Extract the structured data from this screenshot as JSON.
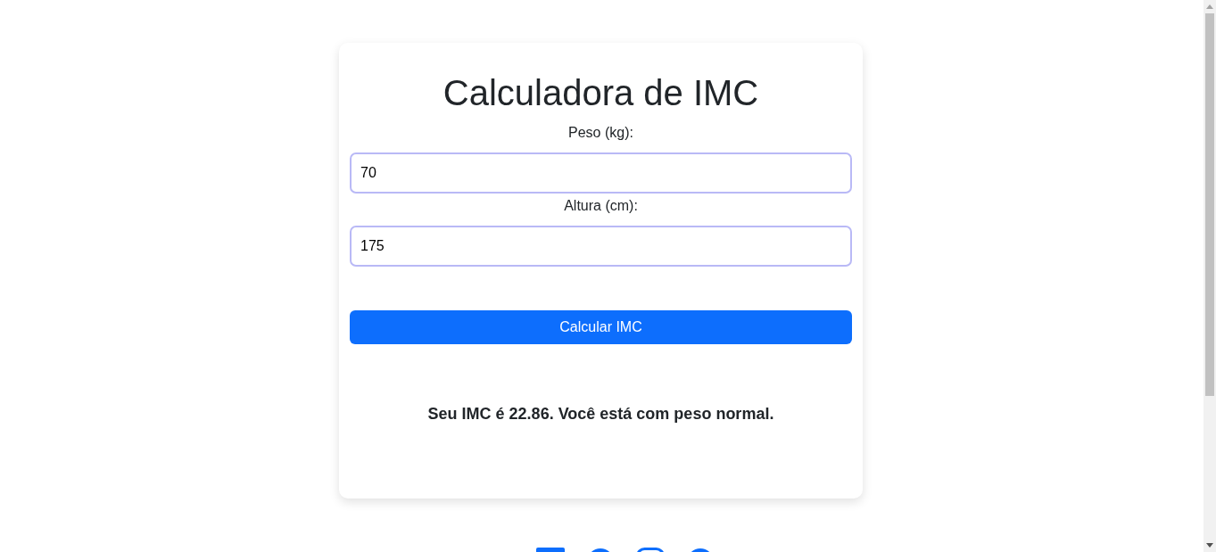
{
  "title": "Calculadora de IMC",
  "fields": [
    {
      "label": "Peso (kg):",
      "value": "70"
    },
    {
      "label": "Altura (cm):",
      "value": "175"
    }
  ],
  "button": "Calcular IMC",
  "result": "Seu IMC é 22.86. Você está com peso normal."
}
